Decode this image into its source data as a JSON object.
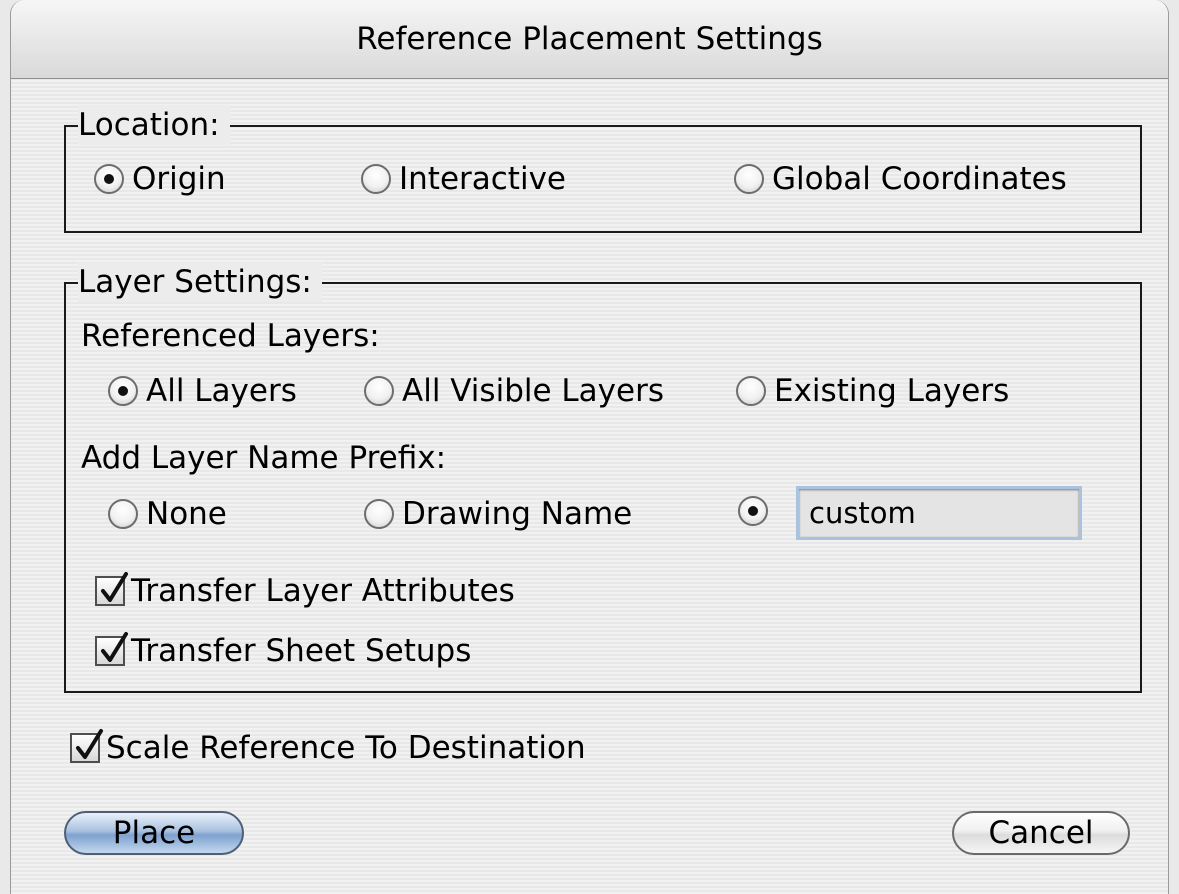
{
  "window": {
    "title": "Reference Placement Settings"
  },
  "location": {
    "legend": "Location:",
    "options": [
      {
        "label": "Origin",
        "selected": true
      },
      {
        "label": "Interactive",
        "selected": false
      },
      {
        "label": "Global Coordinates",
        "selected": false
      }
    ]
  },
  "layer_settings": {
    "legend": "Layer Settings:",
    "referenced_layers": {
      "label": "Referenced Layers:",
      "options": [
        {
          "label": "All Layers",
          "selected": true
        },
        {
          "label": "All Visible Layers",
          "selected": false
        },
        {
          "label": "Existing Layers",
          "selected": false
        }
      ]
    },
    "prefix": {
      "label": "Add Layer Name Prefix:",
      "options": [
        {
          "label": "None",
          "selected": false
        },
        {
          "label": "Drawing Name",
          "selected": false
        },
        {
          "label": "",
          "selected": true
        }
      ],
      "custom_value": "custom"
    },
    "transfer_layer_attributes": {
      "label": "Transfer Layer Attributes",
      "checked": true
    },
    "transfer_sheet_setups": {
      "label": "Transfer Sheet Setups",
      "checked": true
    }
  },
  "scale_to_destination": {
    "label": "Scale Reference To Destination",
    "checked": true
  },
  "buttons": {
    "place": "Place",
    "cancel": "Cancel"
  }
}
